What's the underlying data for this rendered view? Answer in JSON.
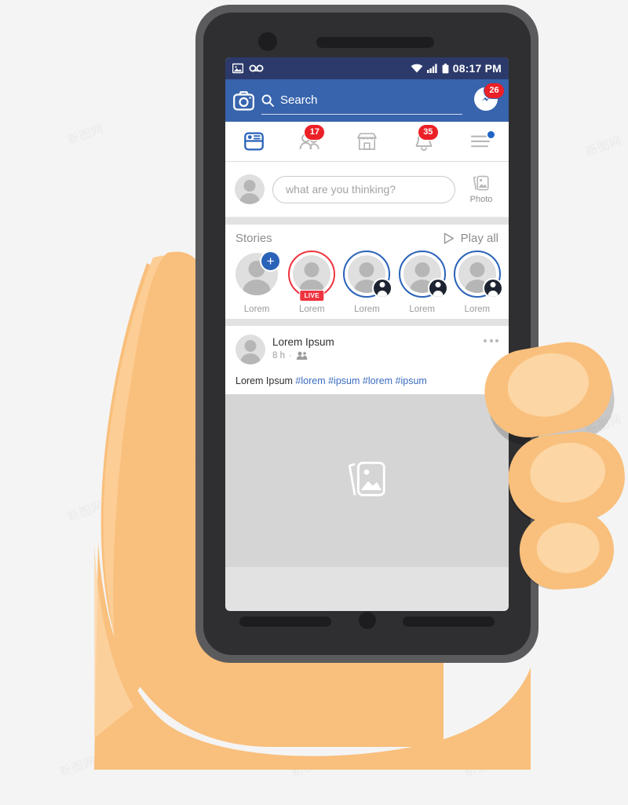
{
  "device": {
    "name": "smartphone-in-hand",
    "body_color": "#5b5b5e",
    "bezel_color": "#2f2f31",
    "hand_color": "#f9bf7c"
  },
  "status_bar": {
    "time": "08:17 PM",
    "icons": [
      "photo-icon",
      "voicemail-icon",
      "wifi-icon",
      "signal-icon",
      "battery-icon"
    ],
    "bg": "#2c3a6b"
  },
  "app_bar": {
    "bg": "#3864ad",
    "camera_icon": "camera-icon",
    "search": {
      "placeholder": "Search",
      "value": "Search",
      "icon": "search-icon"
    },
    "messenger": {
      "icon": "messenger-icon",
      "badge": "26"
    }
  },
  "tabs": [
    {
      "name": "news-feed",
      "icon": "news-feed-icon",
      "active": true,
      "badge": null,
      "dot": false
    },
    {
      "name": "friends",
      "icon": "friends-icon",
      "active": false,
      "badge": "17",
      "dot": false
    },
    {
      "name": "marketplace",
      "icon": "marketplace-icon",
      "active": false,
      "badge": null,
      "dot": false
    },
    {
      "name": "notifications",
      "icon": "notifications-icon",
      "active": false,
      "badge": "35",
      "dot": false
    },
    {
      "name": "menu",
      "icon": "menu-icon",
      "active": false,
      "badge": null,
      "dot": true
    }
  ],
  "composer": {
    "avatar": "user-avatar",
    "placeholder": "what are you thinking?",
    "photo_label": "Photo",
    "photo_icon": "photo-stack-icon"
  },
  "stories": {
    "title": "Stories",
    "play_all_label": "Play all",
    "play_icon": "play-triangle-icon",
    "items": [
      {
        "label": "Lorem",
        "ring": "none",
        "add": true,
        "live": false,
        "mini": false
      },
      {
        "label": "Lorem",
        "ring": "red",
        "add": false,
        "live": true,
        "mini": false,
        "live_label": "LIVE"
      },
      {
        "label": "Lorem",
        "ring": "blue",
        "add": false,
        "live": false,
        "mini": true
      },
      {
        "label": "Lorem",
        "ring": "blue",
        "add": false,
        "live": false,
        "mini": true
      },
      {
        "label": "Lorem",
        "ring": "blue",
        "add": false,
        "live": false,
        "mini": true
      }
    ]
  },
  "post": {
    "author": "Lorem Ipsum",
    "time": "8 h",
    "separator": "·",
    "audience_icon": "friends-audience-icon",
    "more_icon": "more-options-icon",
    "body_text": "Lorem Ipsum ",
    "hashtags": "#lorem #ipsum #lorem #ipsum",
    "image_placeholder_icon": "photo-stack-icon"
  },
  "watermarks": {
    "text": "新图网"
  },
  "colors": {
    "facebook_blue": "#3864ad",
    "accent_blue": "#2a62b8",
    "badge_red": "#ec2027",
    "live_red": "#ee3440",
    "link_blue": "#3c6cc0",
    "skin": "#f9bf7c",
    "skin_light": "#fcd6a4"
  }
}
